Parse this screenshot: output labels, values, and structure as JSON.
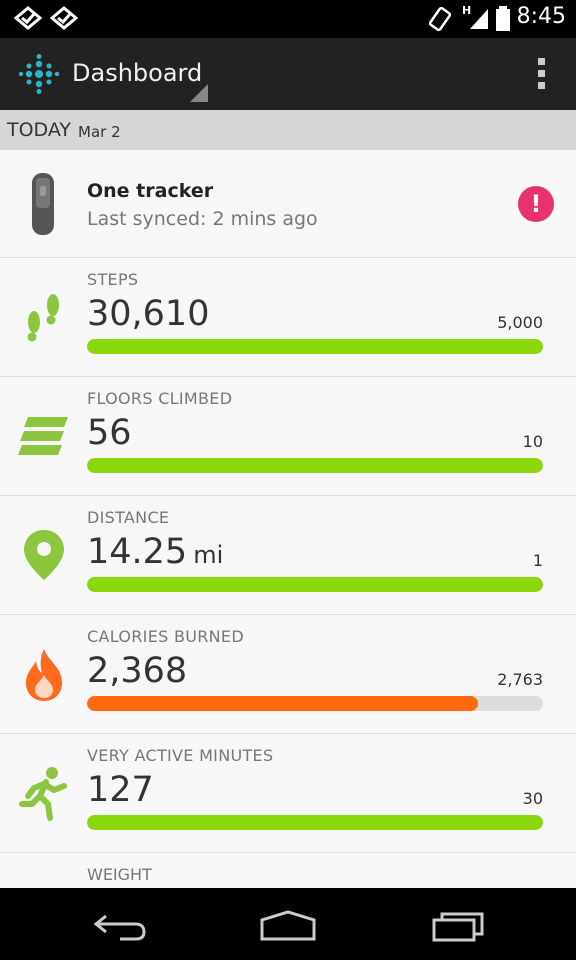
{
  "status_bar": {
    "time": "8:45",
    "network_label": "H",
    "icons": [
      "notification-check-icon",
      "notification-check-icon",
      "vibrate-icon",
      "signal-icon",
      "battery-icon"
    ]
  },
  "action_bar": {
    "title": "Dashboard",
    "logo_icon": "fitbit-logo-icon",
    "menu_icon": "overflow-menu-icon"
  },
  "date_header": {
    "today": "TODAY",
    "date": "Mar 2"
  },
  "tracker": {
    "name": "One tracker",
    "last_synced": "Last synced: 2 mins ago",
    "icon": "tracker-device-icon",
    "alert_icon": "alert-icon",
    "alert_symbol": "!"
  },
  "stats": [
    {
      "id": "steps",
      "label": "STEPS",
      "value": "30,610",
      "unit": "",
      "goal": "5,000",
      "progress": 1.0,
      "color": "#8ad80c",
      "icon": "footsteps-icon"
    },
    {
      "id": "floors",
      "label": "FLOORS CLIMBED",
      "value": "56",
      "unit": "",
      "goal": "10",
      "progress": 1.0,
      "color": "#8ad80c",
      "icon": "stairs-icon"
    },
    {
      "id": "distance",
      "label": "DISTANCE",
      "value": "14.25",
      "unit": "mi",
      "goal": "1",
      "progress": 1.0,
      "color": "#8ad80c",
      "icon": "map-pin-icon"
    },
    {
      "id": "calories",
      "label": "CALORIES BURNED",
      "value": "2,368",
      "unit": "",
      "goal": "2,763",
      "progress": 0.857,
      "color": "#ff6a0c",
      "icon": "flame-icon"
    },
    {
      "id": "active",
      "label": "VERY ACTIVE MINUTES",
      "value": "127",
      "unit": "",
      "goal": "30",
      "progress": 1.0,
      "color": "#8ad80c",
      "icon": "running-person-icon"
    }
  ],
  "weight": {
    "label": "WEIGHT"
  },
  "colors": {
    "accent_green": "#8ad80c",
    "calorie_orange": "#ff6a0c",
    "alert_pink": "#e8336e",
    "icon_green": "#8cc63f"
  },
  "nav_bar": {
    "icons": [
      "back-icon",
      "home-icon",
      "recent-apps-icon"
    ]
  }
}
